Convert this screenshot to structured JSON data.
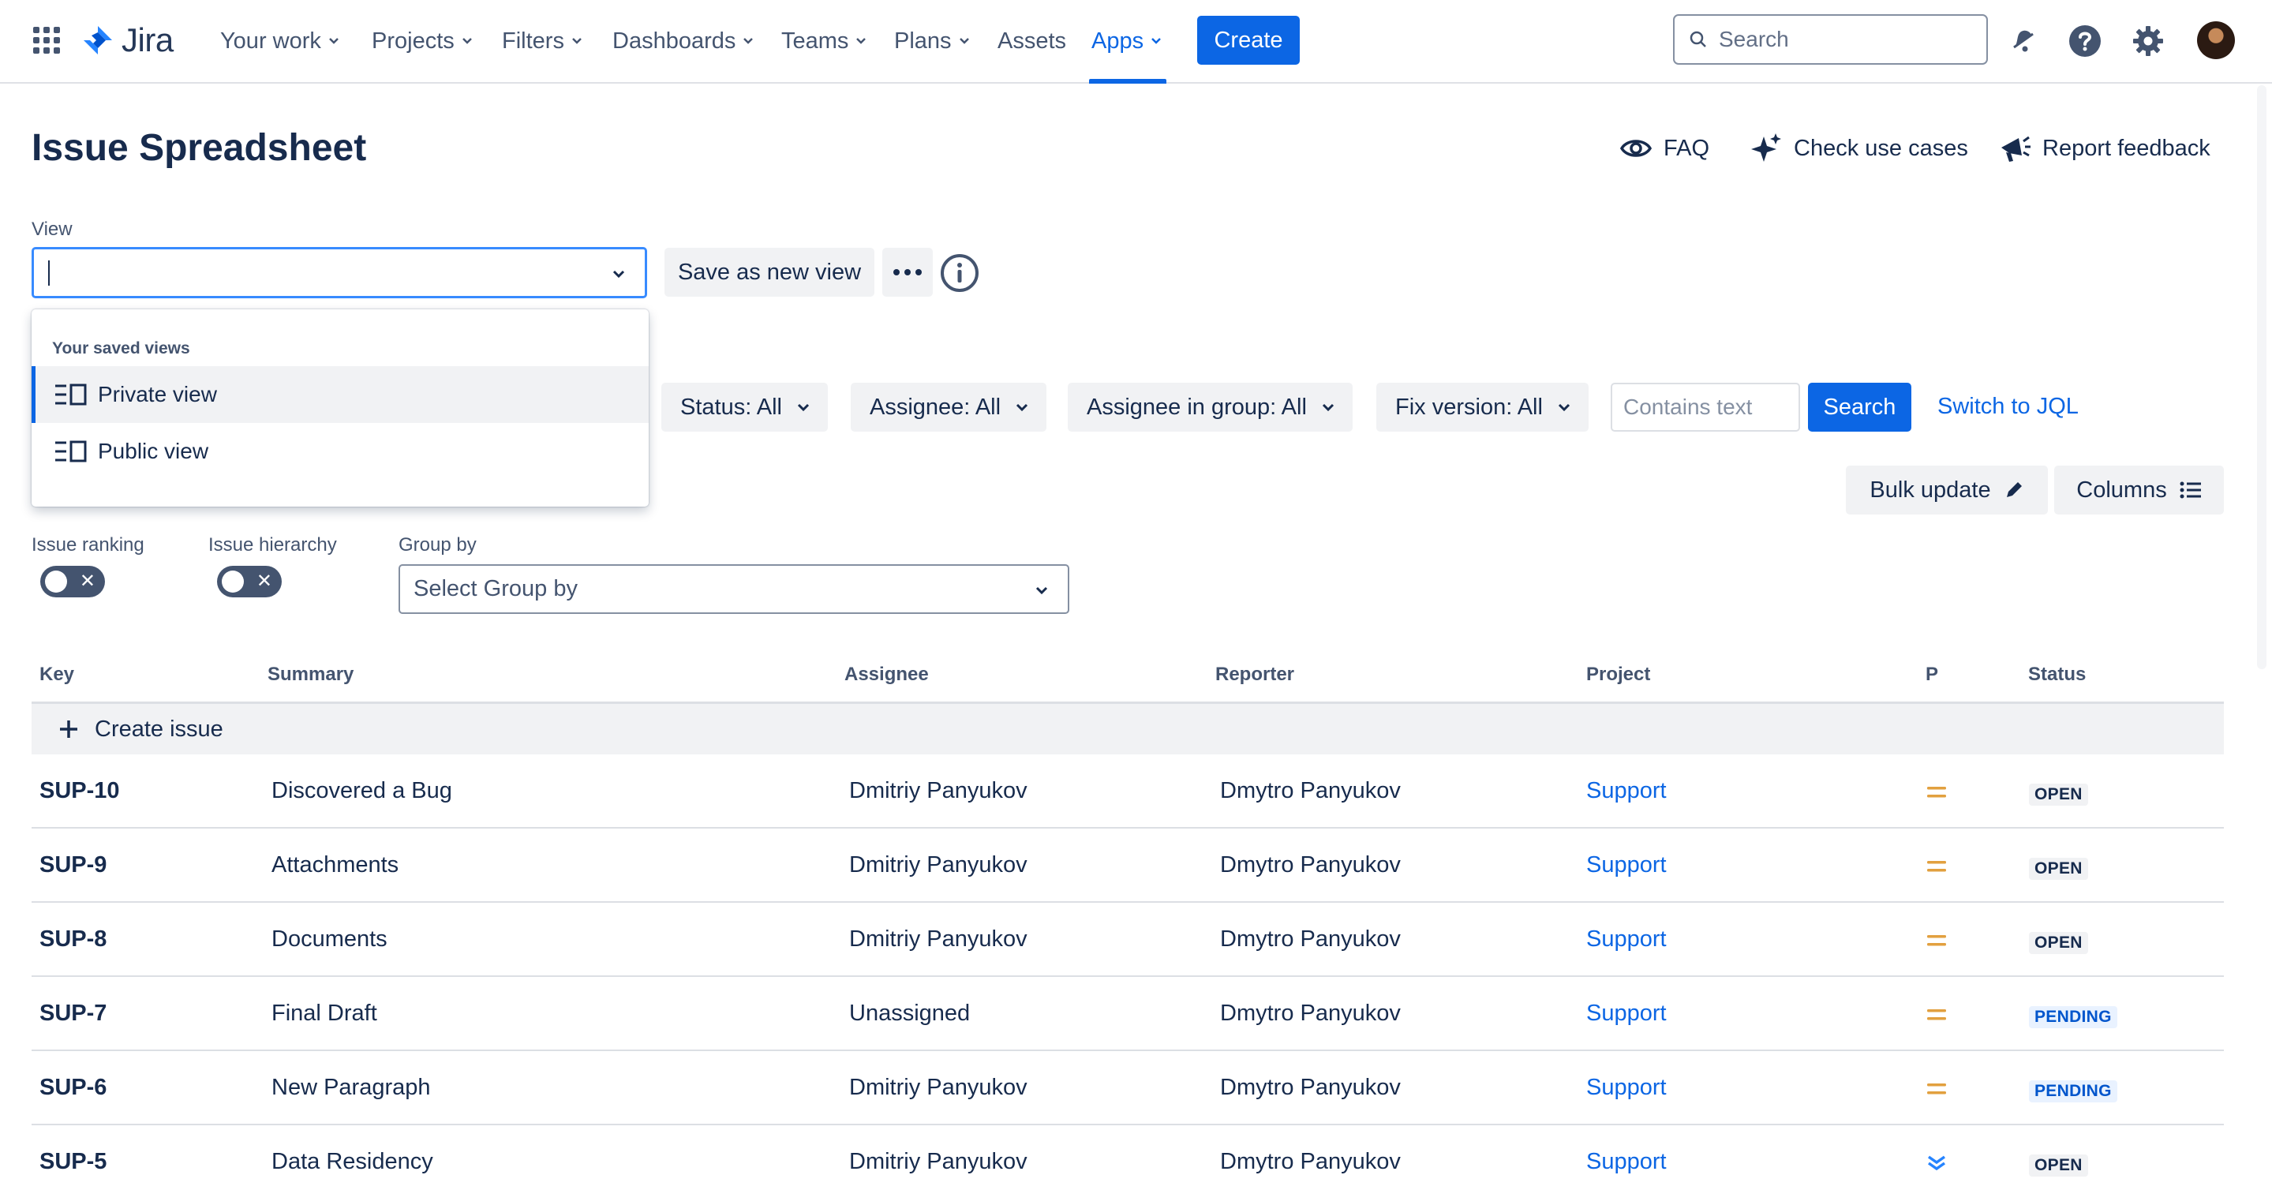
{
  "nav": {
    "logo_text": "Jira",
    "items": [
      "Your work",
      "Projects",
      "Filters",
      "Dashboards",
      "Teams",
      "Plans",
      "Assets",
      "Apps"
    ],
    "create_label": "Create",
    "search_placeholder": "Search"
  },
  "header": {
    "title": "Issue Spreadsheet",
    "faq": "FAQ",
    "check_use_cases": "Check use cases",
    "report_feedback": "Report feedback"
  },
  "view": {
    "label": "View",
    "value": "",
    "save_as_new_view": "Save as new view",
    "dropdown": {
      "heading": "Your saved views",
      "items": [
        "Private view",
        "Public view"
      ]
    }
  },
  "filters": {
    "status": "Status: All",
    "assignee": "Assignee: All",
    "assignee_group": "Assignee in group: All",
    "fix_version": "Fix version: All",
    "text_placeholder": "Contains text",
    "search": "Search",
    "switch_jql": "Switch to JQL"
  },
  "actions": {
    "bulk_update": "Bulk update",
    "columns": "Columns"
  },
  "options": {
    "issue_ranking": "Issue ranking",
    "issue_hierarchy": "Issue hierarchy",
    "group_by_label": "Group by",
    "group_by_placeholder": "Select Group by"
  },
  "table": {
    "columns": [
      "Key",
      "Summary",
      "Assignee",
      "Reporter",
      "Project",
      "P",
      "Status"
    ],
    "create_issue": "Create issue",
    "rows": [
      {
        "key": "SUP-10",
        "summary": "Discovered a Bug",
        "assignee": "Dmitriy Panyukov",
        "reporter": "Dmytro Panyukov",
        "project": "Support",
        "priority": "medium",
        "status": "OPEN"
      },
      {
        "key": "SUP-9",
        "summary": "Attachments",
        "assignee": "Dmitriy Panyukov",
        "reporter": "Dmytro Panyukov",
        "project": "Support",
        "priority": "medium",
        "status": "OPEN"
      },
      {
        "key": "SUP-8",
        "summary": "Documents",
        "assignee": "Dmitriy Panyukov",
        "reporter": "Dmytro Panyukov",
        "project": "Support",
        "priority": "medium",
        "status": "OPEN"
      },
      {
        "key": "SUP-7",
        "summary": "Final Draft",
        "assignee": "Unassigned",
        "reporter": "Dmytro Panyukov",
        "project": "Support",
        "priority": "medium",
        "status": "PENDING"
      },
      {
        "key": "SUP-6",
        "summary": "New Paragraph",
        "assignee": "Dmitriy Panyukov",
        "reporter": "Dmytro Panyukov",
        "project": "Support",
        "priority": "medium",
        "status": "PENDING"
      },
      {
        "key": "SUP-5",
        "summary": "Data Residency",
        "assignee": "Dmitriy Panyukov",
        "reporter": "Dmytro Panyukov",
        "project": "Support",
        "priority": "lowest",
        "status": "OPEN"
      }
    ]
  },
  "colors": {
    "brand_blue": "#0c66e4",
    "priority_medium": "#e2a03f",
    "priority_lowest": "#2684ff",
    "text": "#172b4d",
    "subtle_text": "#44546f"
  },
  "icons": [
    "app-switcher-icon",
    "jira-logo-icon",
    "chevron-down-icon",
    "search-icon",
    "notification-bell-icon",
    "help-icon",
    "settings-gear-icon",
    "eye-icon",
    "sparkle-icon",
    "megaphone-icon",
    "more-dots-icon",
    "info-icon",
    "view-list-icon",
    "pencil-icon",
    "columns-list-icon",
    "plus-icon",
    "priority-medium-icon",
    "priority-lowest-icon"
  ]
}
